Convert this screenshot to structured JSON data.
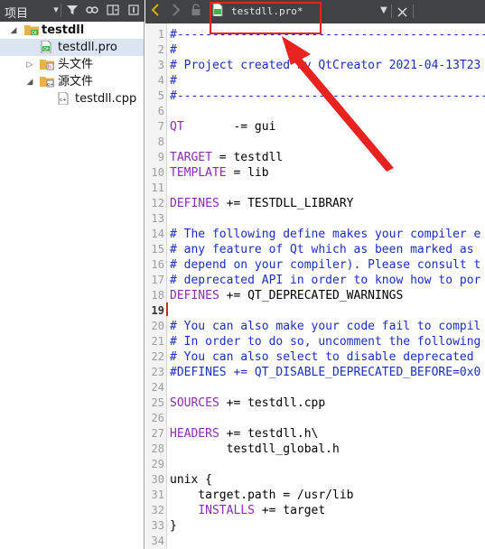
{
  "left": {
    "panel_title": "项目",
    "tree": [
      {
        "label": "testdll",
        "bold": true
      },
      {
        "label": "testdll.pro"
      },
      {
        "label": "头文件"
      },
      {
        "label": "源文件"
      },
      {
        "label": "testdll.cpp"
      }
    ]
  },
  "editor": {
    "tab_title": "testdll.pro*",
    "current_line": 19,
    "line_numbers": [
      "1",
      "2",
      "3",
      "4",
      "5",
      "6",
      "7",
      "8",
      "9",
      "10",
      "11",
      "12",
      "13",
      "14",
      "15",
      "16",
      "17",
      "18",
      "19",
      "20",
      "21",
      "22",
      "23",
      "24",
      "25",
      "26",
      "27",
      "28",
      "29",
      "30",
      "31",
      "32",
      "33",
      "34"
    ],
    "lines": [
      "#-------------------------------------------------",
      "#",
      "# Project created by QtCreator 2021-04-13T23",
      "#",
      "#-------------------------------------------------",
      "",
      "QT       -= gui",
      "",
      "TARGET = testdll",
      "TEMPLATE = lib",
      "",
      "DEFINES += TESTDLL_LIBRARY",
      "",
      "# The following define makes your compiler e",
      "# any feature of Qt which as been marked as",
      "# depend on your compiler). Please consult t",
      "# deprecated API in order to know how to por",
      "DEFINES += QT_DEPRECATED_WARNINGS",
      "",
      "# You can also make your code fail to compil",
      "# In order to do so, uncomment the following",
      "# You can also select to disable deprecated",
      "#DEFINES += QT_DISABLE_DEPRECATED_BEFORE=0x0",
      "",
      "SOURCES += testdll.cpp",
      "",
      "HEADERS += testdll.h\\",
      "        testdll_global.h",
      "",
      "unix {",
      "    target.path = /usr/lib",
      "    INSTALLS += target",
      "}",
      ""
    ]
  },
  "colors": {
    "toolbar_bg": "#404244",
    "selected_row": "#dbe5f2",
    "comment": "#1b2ec7",
    "keyword": "#8a2bb5",
    "annotation": "#e8231f"
  }
}
